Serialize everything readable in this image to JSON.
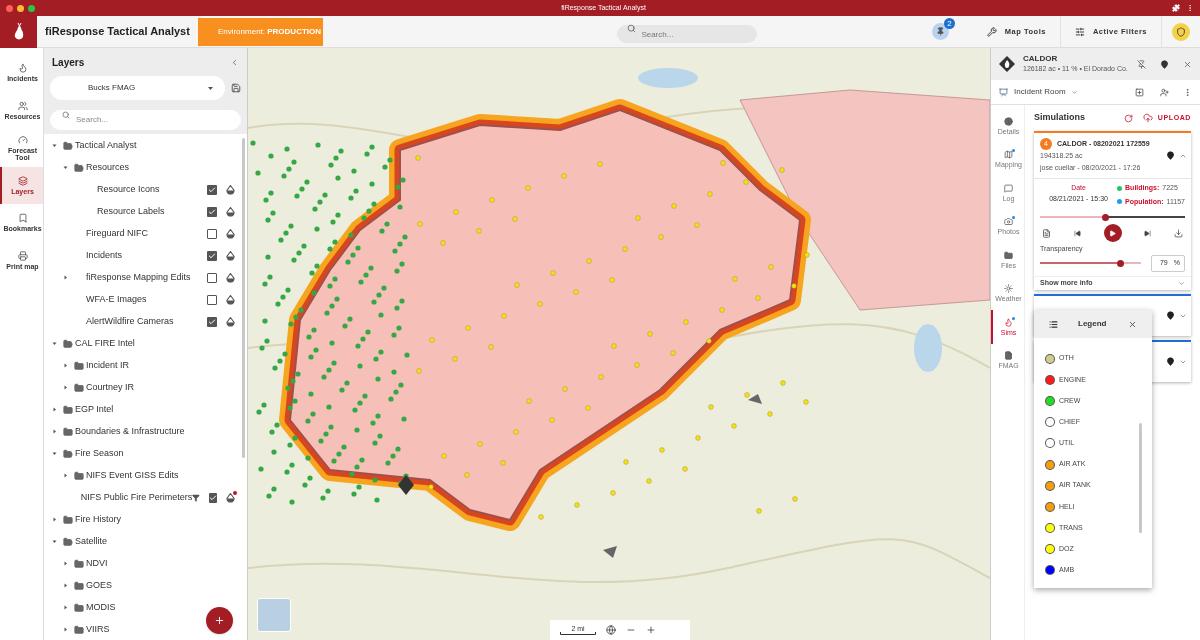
{
  "window": {
    "title": "fiResponse Tactical Analyst"
  },
  "header": {
    "app_name": "fiResponse Tactical Analyst",
    "environment": "Environment: **PRODUCTION**",
    "search": {
      "placeholder": "Search..."
    },
    "pins_badge": "2",
    "buttons": [
      {
        "label": "Map Tools",
        "kind": "tools"
      },
      {
        "label": "Active Filters",
        "kind": "filters"
      }
    ]
  },
  "nav": [
    {
      "label": "Incidents",
      "selected": false
    },
    {
      "label": "Resources",
      "selected": false
    },
    {
      "label": "Forecast Tool",
      "selected": false
    },
    {
      "label": "Layers",
      "selected": true
    },
    {
      "label": "Bookmarks",
      "selected": false
    },
    {
      "label": "Print map",
      "selected": false
    }
  ],
  "layers_panel": {
    "title": "Layers",
    "preset": "Bucks FMAG",
    "search": {
      "placeholder": "Search..."
    },
    "tree": [
      {
        "kind": "folder",
        "label": "Tactical Analyst",
        "expanded": true,
        "children": [
          {
            "kind": "folder",
            "label": "Resources",
            "expanded": true,
            "children": [
              {
                "kind": "layer",
                "label": "Resource Icons",
                "checked": true
              },
              {
                "kind": "layer",
                "label": "Resource Labels",
                "checked": true
              }
            ]
          },
          {
            "kind": "layer",
            "label": "Fireguard NIFC",
            "checked": false
          },
          {
            "kind": "layer",
            "label": "Incidents",
            "checked": true
          },
          {
            "kind": "layer",
            "label": "fiResponse Mapping Edits",
            "checked": false,
            "expanded": false
          },
          {
            "kind": "layer",
            "label": "WFA-E Images",
            "checked": false
          },
          {
            "kind": "layer",
            "label": "AlertWildfire Cameras",
            "checked": true
          }
        ]
      },
      {
        "kind": "folder",
        "label": "CAL FIRE Intel",
        "expanded": true,
        "children": [
          {
            "kind": "folder",
            "label": "Incident IR",
            "expanded": false
          },
          {
            "kind": "folder",
            "label": "Courtney IR",
            "expanded": false
          }
        ]
      },
      {
        "kind": "folder",
        "label": "EGP Intel",
        "expanded": false
      },
      {
        "kind": "folder",
        "label": "Boundaries & Infrastructure",
        "expanded": false
      },
      {
        "kind": "folder",
        "label": "Fire Season",
        "expanded": true,
        "children": [
          {
            "kind": "folder",
            "label": "NIFS Event GISS Edits",
            "expanded": false
          },
          {
            "kind": "layer",
            "label": "NIFS Public Fire Perimeters",
            "checked": true,
            "filter": true,
            "alert": true
          }
        ]
      },
      {
        "kind": "folder",
        "label": "Fire History",
        "expanded": false
      },
      {
        "kind": "folder",
        "label": "Satellite",
        "expanded": true,
        "children": [
          {
            "kind": "folder",
            "label": "NDVI",
            "expanded": false
          },
          {
            "kind": "folder",
            "label": "GOES",
            "expanded": false
          },
          {
            "kind": "folder",
            "label": "MODIS",
            "expanded": false
          },
          {
            "kind": "folder",
            "label": "VIIRS",
            "expanded": false
          }
        ]
      }
    ]
  },
  "map": {
    "scale": "2 mi"
  },
  "incident": {
    "name": "CALDOR",
    "summary": "126182 ac • 11 % • El Dorado Co.",
    "room": "Incident Room",
    "tabs": [
      {
        "label": "Details",
        "selected": false,
        "badge": false
      },
      {
        "label": "Mapping",
        "selected": false,
        "badge": true
      },
      {
        "label": "Log",
        "selected": false,
        "badge": false
      },
      {
        "label": "Photos",
        "selected": false,
        "badge": true
      },
      {
        "label": "Files",
        "selected": false,
        "badge": false
      },
      {
        "label": "Weather",
        "selected": false,
        "badge": false
      },
      {
        "label": "Sims",
        "selected": true,
        "badge": true
      },
      {
        "label": "FMAG",
        "selected": false,
        "badge": false
      }
    ],
    "section_title": "Simulations",
    "upload": "UPLOAD",
    "simulations": [
      {
        "expanded": true,
        "color": "#f47b20",
        "number": "4",
        "title": "CALDOR - 08202021 172559",
        "area": "194318.25 ac",
        "author": "jose cuellar - 08/20/2021 - 17:26",
        "date_label": "Date",
        "date": "08/21/2021 - 15:30",
        "stats": [
          {
            "label": "Buildings:",
            "value": "7225",
            "color": "#22c55e"
          },
          {
            "label": "Population:",
            "value": "11157",
            "color": "#1e9bf0"
          }
        ],
        "timeline": {
          "level": 0.45
        },
        "transparency_label": "Transparency",
        "transparency": {
          "level": 0.8,
          "value": "79",
          "unit": "%"
        },
        "more": "Show more info"
      },
      {
        "expanded": false,
        "color": "#1e6fd0"
      },
      {
        "expanded": false,
        "color": "#1e6fd0"
      }
    ]
  },
  "legend": {
    "title": "Legend",
    "items": [
      {
        "label": "OTH",
        "color": "#cfcc8c"
      },
      {
        "label": "ENGINE",
        "color": "#ff1a1a"
      },
      {
        "label": "CREW",
        "color": "#22dd22"
      },
      {
        "label": "CHIEF",
        "color": "#ffffff"
      },
      {
        "label": "UTIL",
        "color": "#ffffff"
      },
      {
        "label": "AIR ATK",
        "color": "#f59e0b"
      },
      {
        "label": "AIR TANK",
        "color": "#f59e0b"
      },
      {
        "label": "HELI",
        "color": "#f59e0b"
      },
      {
        "label": "TRANS",
        "color": "#ffff00"
      },
      {
        "label": "DOZ",
        "color": "#ffff00"
      },
      {
        "label": "AMB",
        "color": "#0000ff"
      }
    ]
  }
}
